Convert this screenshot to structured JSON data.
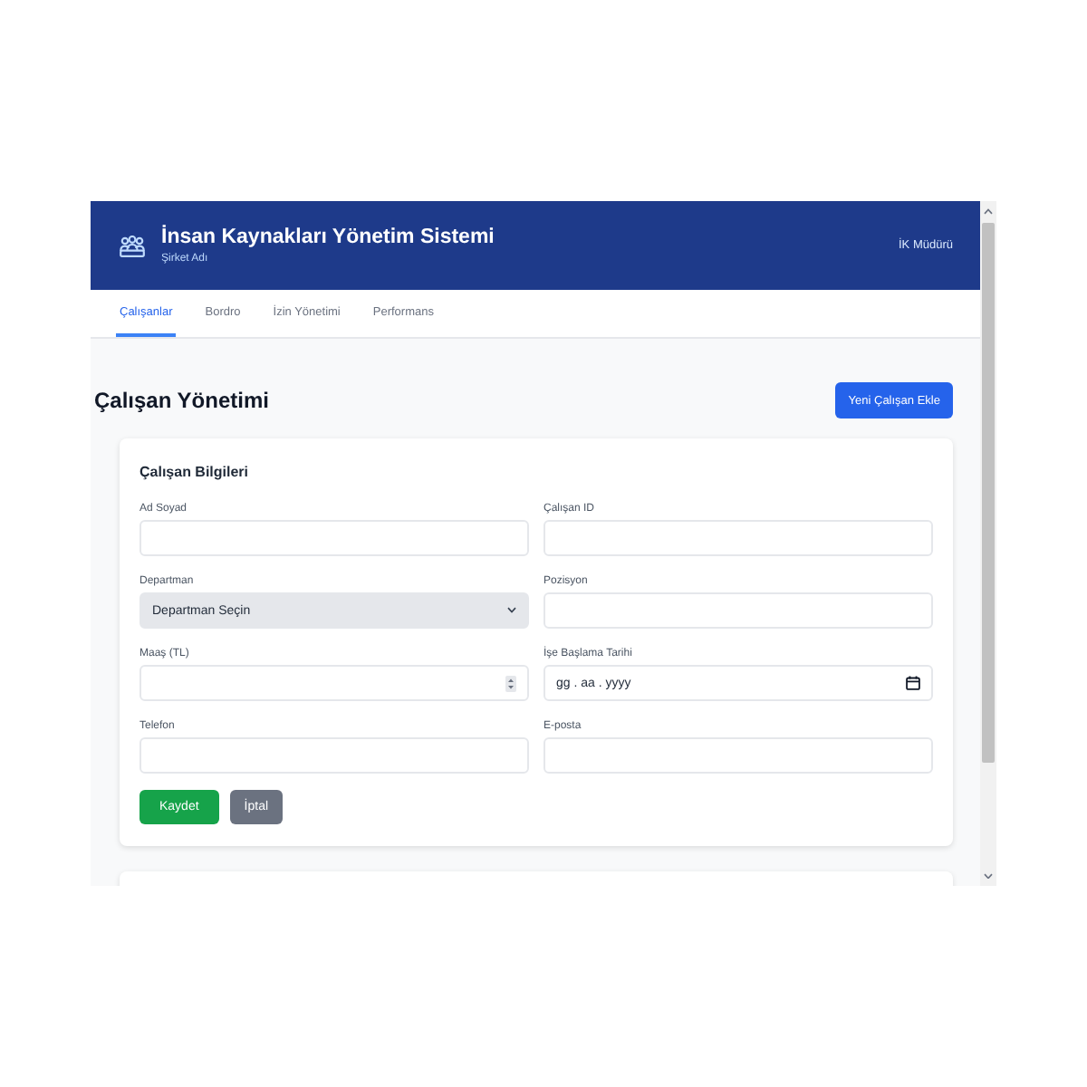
{
  "header": {
    "title": "İnsan Kaynakları Yönetim Sistemi",
    "subtitle": "Şirket Adı",
    "user": "İK Müdürü"
  },
  "tabs": [
    {
      "label": "Çalışanlar",
      "selected": true
    },
    {
      "label": "Bordro",
      "selected": false
    },
    {
      "label": "İzin Yönetimi",
      "selected": false
    },
    {
      "label": "Performans",
      "selected": false
    }
  ],
  "page": {
    "title": "Çalışan Yönetimi",
    "add_button": "Yeni Çalışan Ekle"
  },
  "form": {
    "title": "Çalışan Bilgileri",
    "fields": [
      {
        "label": "Ad Soyad",
        "kind": "text"
      },
      {
        "label": "Çalışan ID",
        "kind": "text"
      },
      {
        "label": "Departman",
        "kind": "select",
        "value": "Departman Seçin"
      },
      {
        "label": "Pozisyon",
        "kind": "text"
      },
      {
        "label": "Maaş (TL)",
        "kind": "number"
      },
      {
        "label": "İşe Başlama Tarihi",
        "kind": "date",
        "placeholder": "gg . aa . yyyy"
      },
      {
        "label": "Telefon",
        "kind": "text"
      },
      {
        "label": "E-posta",
        "kind": "text"
      }
    ],
    "buttons": [
      {
        "label": "Kaydet",
        "kind": "primary"
      },
      {
        "label": "İptal",
        "kind": "secondary"
      }
    ]
  }
}
